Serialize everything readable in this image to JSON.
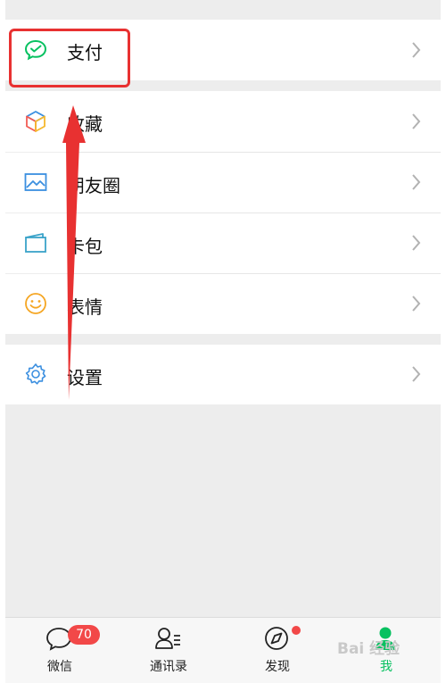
{
  "menu": {
    "pay": {
      "label": "支付",
      "icon": "wechat-pay-icon"
    },
    "items": [
      {
        "label": "收藏",
        "icon": "favorites-cube-icon"
      },
      {
        "label": "朋友圈",
        "icon": "moments-image-icon"
      },
      {
        "label": "卡包",
        "icon": "card-wallet-icon"
      },
      {
        "label": "表情",
        "icon": "sticker-smiley-icon"
      }
    ],
    "settings": {
      "label": "设置",
      "icon": "gear-icon"
    }
  },
  "tabbar": {
    "tabs": [
      {
        "label": "微信",
        "icon": "chat-bubble-icon",
        "badge": "70"
      },
      {
        "label": "通讯录",
        "icon": "contacts-icon"
      },
      {
        "label": "发现",
        "icon": "compass-icon"
      },
      {
        "label": "我",
        "icon": "person-icon"
      }
    ]
  },
  "watermark": "Bai 经验",
  "colors": {
    "accent_green": "#07c160",
    "badge_red": "#f24848",
    "annotation_red": "#e83131",
    "background": "#ededed"
  }
}
